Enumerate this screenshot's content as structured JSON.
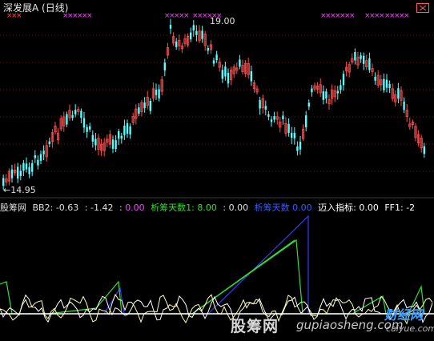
{
  "header": {
    "title": "深发展A (日线)",
    "close_icon": "close-icon"
  },
  "price_panel": {
    "high_label": "19.00",
    "low_label": "←14.95"
  },
  "indicator_bar": {
    "name": "股筹网",
    "bb2_label": "BB2:",
    "bb2_value": "-0.63",
    "sep1": ":",
    "value2": "-1.42",
    "sep2": ":",
    "value3": "0.00",
    "xichou1_label": "析筹天数1:",
    "xichou1_value": "8.00",
    "sep3": ":",
    "value4": "0.00",
    "xichou_label": "析筹天数",
    "xichou_value": "0.00",
    "enter_label": "迈入指标:",
    "enter_value": "0.00",
    "ff1_label": "FF1:",
    "ff1_value": "-2"
  },
  "watermarks": {
    "w1": "股筹网",
    "w2": "gupiaosheng.com",
    "w3": "财经网",
    "w4": "caiyue.com"
  },
  "colors": {
    "up": "#ff4c4c",
    "down": "#54ffff",
    "magenta": "#ff40ff",
    "blue": "#3a3aff",
    "green": "#33dd33",
    "yellow": "#ffffaa",
    "white": "#ffffff"
  }
}
